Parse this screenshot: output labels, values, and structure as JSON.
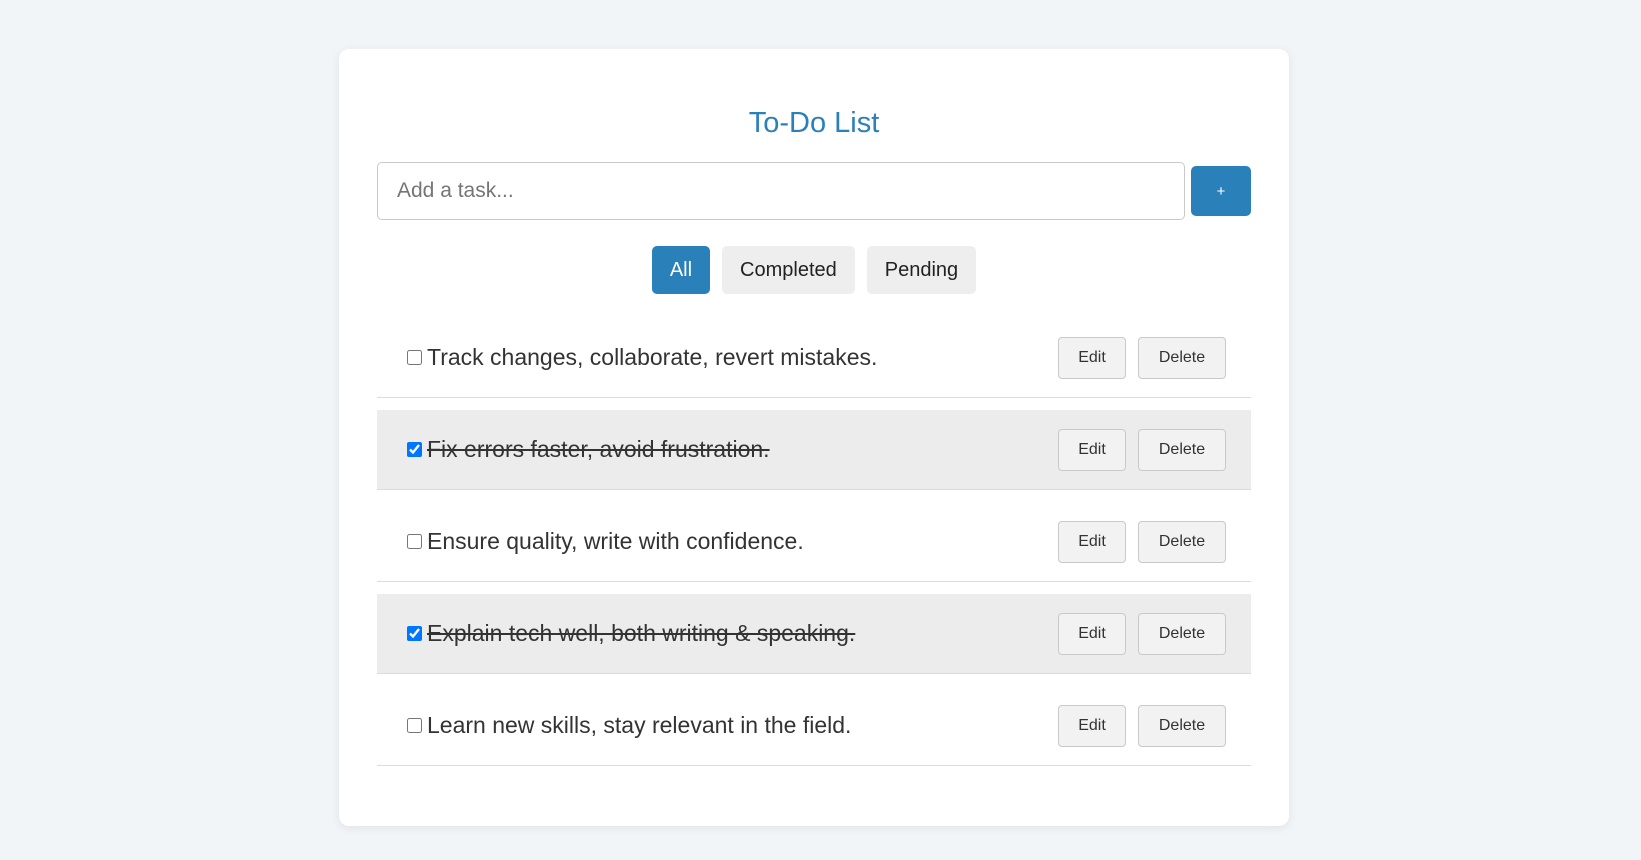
{
  "app": {
    "title": "To-Do List"
  },
  "add_form": {
    "placeholder": "Add a task...",
    "value": "",
    "add_label": "+"
  },
  "filters": [
    {
      "label": "All",
      "active": true
    },
    {
      "label": "Completed",
      "active": false
    },
    {
      "label": "Pending",
      "active": false
    }
  ],
  "tasks": [
    {
      "text": "Track changes, collaborate, revert mistakes.",
      "completed": false,
      "edit_label": "Edit",
      "delete_label": "Delete"
    },
    {
      "text": "Fix errors faster, avoid frustration.",
      "completed": true,
      "edit_label": "Edit",
      "delete_label": "Delete"
    },
    {
      "text": "Ensure quality, write with confidence.",
      "completed": false,
      "edit_label": "Edit",
      "delete_label": "Delete"
    },
    {
      "text": "Explain tech well, both writing & speaking.",
      "completed": true,
      "edit_label": "Edit",
      "delete_label": "Delete"
    },
    {
      "text": "Learn new skills, stay relevant in the field.",
      "completed": false,
      "edit_label": "Edit",
      "delete_label": "Delete"
    }
  ],
  "colors": {
    "accent": "#2a80b9",
    "page_background": "#f2f5f8",
    "completed_row_background": "#ececec"
  }
}
